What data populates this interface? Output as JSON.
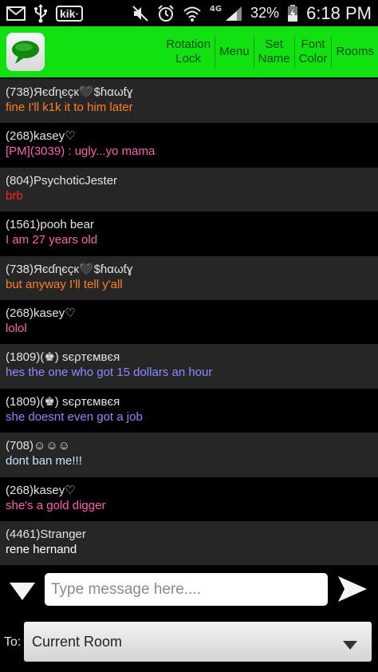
{
  "status_bar": {
    "left_icons": [
      "mail-icon",
      "usb-icon",
      "kik-icon"
    ],
    "kik_text": "kik·",
    "network_text": "4G",
    "battery_percent": "32%",
    "time": "6:18 PM"
  },
  "toolbar": {
    "buttons": [
      {
        "label": "Rotation\nLock"
      },
      {
        "label": "Menu"
      },
      {
        "label": "Set\nName"
      },
      {
        "label": "Font\nColor"
      },
      {
        "label": "Rooms"
      }
    ]
  },
  "messages": [
    {
      "user": "(738)Яєɗɳєçк🖤$ɦαωƭɣ",
      "text": "fine I'll k1k it to him later",
      "color": "#ff7f27"
    },
    {
      "user": "(268)kasey♡",
      "text": "[PM](3039) : ugly...yo mama",
      "color": "#ff5fb4"
    },
    {
      "user": "(804)PsychoticJester",
      "text": "brb",
      "color": "#ff2020"
    },
    {
      "user": "(1561)pooh bear",
      "text": "I am 27 years old",
      "color": "#ff5fb4"
    },
    {
      "user": "(738)Яєɗɳєçк🖤$ɦαωƭɣ",
      "text": "but anyway I'll tell y'all",
      "color": "#ff7f27"
    },
    {
      "user": "(268)kasey♡",
      "text": "lolol",
      "color": "#ff5fb4"
    },
    {
      "user": "(1809)(♚) ѕєρтємвєя",
      "text": "hes the one who got 15 dollars an hour",
      "color": "#8c8cff"
    },
    {
      "user": "(1809)(♚) ѕєρтємвєя",
      "text": "she doesnt even got a job",
      "color": "#8c8cff"
    },
    {
      "user": "(708)☺☺☺",
      "text": "dont ban me!!!",
      "color": "#c8e6ff"
    },
    {
      "user": "(268)kasey♡",
      "text": "she's a gold digger",
      "color": "#ff5fb4"
    },
    {
      "user": "(4461)Stranger",
      "text": "rene hernand",
      "color": "#ffffff"
    }
  ],
  "composer": {
    "placeholder": "Type message here....",
    "value": ""
  },
  "room": {
    "to_label": "To:",
    "selected": "Current Room"
  }
}
